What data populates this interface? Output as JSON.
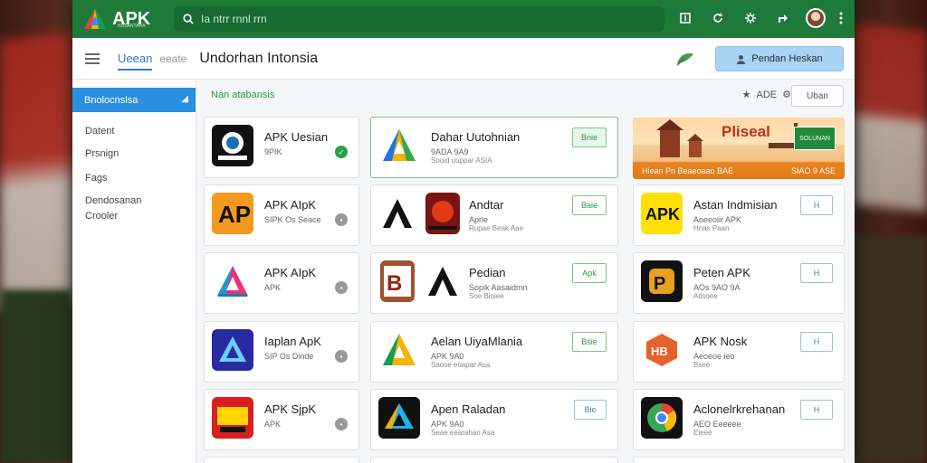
{
  "topbar": {
    "logo_text": "APK",
    "logo_sub": "NUSANTARA",
    "search_placeholder": "Ia ntrr rnnl rrn",
    "icons": [
      "download-icon",
      "refresh-icon",
      "settings-icon",
      "share-icon",
      "avatar",
      "more-icon"
    ]
  },
  "subbar": {
    "crumb_active": "Ueean",
    "crumb_inactive": "eeate",
    "title": "Undorhan Intonsia",
    "primary_button": "Pendan Heskan"
  },
  "sidebar": {
    "active_item": "Bnolocnslsa",
    "items": [
      "Datent",
      "Prsnign",
      "Fags",
      "Dendosanan",
      "Crooler"
    ]
  },
  "filterbar": {
    "label": "Nan atabansis",
    "sort_text": "ADE",
    "view_button": "Uban"
  },
  "apps": [
    {
      "title": "APK Uesian",
      "sub": "9PIK",
      "sub2": "",
      "action": "check",
      "icon": "chrome-like-icon"
    },
    {
      "title": "Dahar Uutohnian",
      "sub": "9ADA 9A9",
      "sub2": "Sooid uuppar ASIA",
      "action": "Bnie",
      "icon": "apk-triangle-icon"
    },
    {
      "title": "APK AIpK",
      "sub": "SIPK Os Seace",
      "sub2": "",
      "action": "dot",
      "icon": "ap-logo-icon"
    },
    {
      "title": "Andtar",
      "sub": "Aprle",
      "sub2": "Rupae Beak Aae",
      "action": "Baie",
      "icon": "arrow-logo-icon"
    },
    {
      "title": "Astan Indmisian",
      "sub": "Aoeeoiir APK",
      "sub2": "Hnas Paan",
      "action": "H",
      "icon": "apk-yellow-icon"
    },
    {
      "title": "APK AIpK",
      "sub": "APK",
      "sub2": "",
      "action": "dot",
      "icon": "a-gradient-icon"
    },
    {
      "title": "Pedian",
      "sub": "Sopik Aasaidmn",
      "sub2": "Soe Bioiee",
      "action": "Apk",
      "icon": "b-apk-icon"
    },
    {
      "title": "Peten APK",
      "sub": "AOs 9AO 9A",
      "sub2": "Atlsoee",
      "action": "H",
      "icon": "p-logo-icon"
    },
    {
      "title": "Iaplan ApK",
      "sub": "SIP Os Dinde",
      "sub2": "",
      "action": "dot",
      "icon": "blue-a-icon"
    },
    {
      "title": "Aelan UiyaMlania",
      "sub": "APK 9A0",
      "sub2": "Saose eoapar Asa",
      "action": "Bsie",
      "icon": "green-triangle-icon"
    },
    {
      "title": "APK Nosk",
      "sub": "Aeoeoe ieo",
      "sub2": "Bsee",
      "action": "H",
      "icon": "hex-apk-icon"
    },
    {
      "title": "APK SjpK",
      "sub": "APK",
      "sub2": "",
      "action": "dot",
      "icon": "game-icon"
    },
    {
      "title": "Apen Raladan",
      "sub": "APK 9A0",
      "sub2": "Seae eearahan Asa",
      "action": "Bie",
      "icon": "a-dark-icon"
    },
    {
      "title": "Aclonelrkrehanan",
      "sub": "AEO Eeeeee",
      "sub2": "Eieee",
      "action": "H",
      "icon": "chrome-icon"
    }
  ],
  "banner": {
    "title": "Pliseal",
    "green_text": "SOLUNAN",
    "foot_left": "Hiean Pn Beaeoaao BAE",
    "foot_right": "SIAO 9 ASE"
  },
  "colors": {
    "topbar": "#1f7a3a",
    "accent": "#2b8fe0",
    "install_green": "#2a9a4a"
  }
}
